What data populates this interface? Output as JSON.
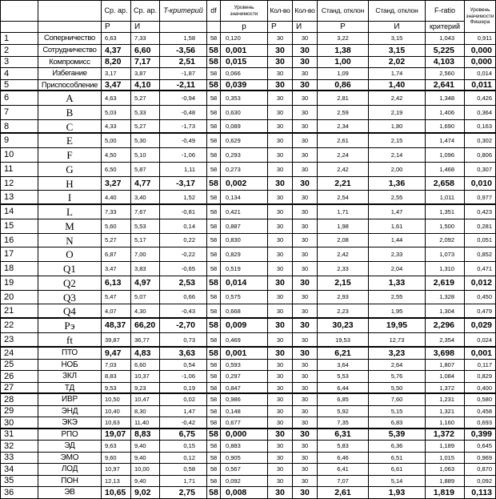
{
  "header": {
    "top": [
      "",
      "",
      "Ср. ар.",
      "Ср. ар.",
      "T-критерий",
      "df",
      "Уровень значимости",
      "Кол-во",
      "Кол-во",
      "Станд. отклон",
      "Станд. отклон",
      "F-ratio",
      "Уровень значимости Фишера"
    ],
    "sub": [
      "",
      "",
      "Р",
      "И",
      "",
      "",
      "р",
      "Р",
      "И",
      "Р",
      "И",
      "критерий"
    ]
  },
  "rows": [
    {
      "no": "1",
      "name": "Соперничество",
      "values": [
        "6,63",
        "7,33",
        "1,58",
        "58",
        "0,120",
        "30",
        "30",
        "3,22",
        "3,15",
        "1,043",
        "0,911"
      ],
      "bold": false
    },
    {
      "no": "2",
      "name": "Сотрудничество",
      "values": [
        "4,37",
        "6,60",
        "-3,56",
        "58",
        "0,001",
        "30",
        "30",
        "1,38",
        "3,15",
        "5,225",
        "0,000"
      ],
      "bold": true
    },
    {
      "no": "3",
      "name": "Компромисс",
      "values": [
        "8,20",
        "7,17",
        "2,51",
        "58",
        "0,015",
        "30",
        "30",
        "1,00",
        "2,02",
        "4,103",
        "0,000"
      ],
      "bold": true
    },
    {
      "no": "4",
      "name": "Избегание",
      "values": [
        "3,17",
        "3,87",
        "-1,87",
        "58",
        "0,066",
        "30",
        "30",
        "1,09",
        "1,74",
        "2,560",
        "0,014"
      ],
      "bold": false
    },
    {
      "no": "5",
      "name": "Приспособление",
      "values": [
        "3,47",
        "4,10",
        "-2,11",
        "58",
        "0,039",
        "30",
        "30",
        "0,86",
        "1,40",
        "2,641",
        "0,011"
      ],
      "bold": true
    },
    {
      "no": "6",
      "name": "A",
      "values": [
        "4,63",
        "5,27",
        "-0,94",
        "58",
        "0,353",
        "30",
        "30",
        "2,81",
        "2,42",
        "1,348",
        "0,426"
      ],
      "bold": false
    },
    {
      "no": "7",
      "name": "B",
      "values": [
        "5,03",
        "5,33",
        "-0,48",
        "58",
        "0,630",
        "30",
        "30",
        "2,59",
        "2,19",
        "1,406",
        "0,364"
      ],
      "bold": false
    },
    {
      "no": "8",
      "name": "C",
      "values": [
        "4,33",
        "5,27",
        "-1,73",
        "58",
        "0,089",
        "30",
        "30",
        "2,34",
        "1,80",
        "1,690",
        "0,163"
      ],
      "bold": false
    },
    {
      "no": "9",
      "name": "E",
      "values": [
        "5,00",
        "5,30",
        "-0,49",
        "58",
        "0,629",
        "30",
        "30",
        "2,61",
        "2,15",
        "1,474",
        "0,302"
      ],
      "bold": false
    },
    {
      "no": "10",
      "name": "F",
      "values": [
        "4,50",
        "5,10",
        "-1,06",
        "58",
        "0,293",
        "30",
        "30",
        "2,24",
        "2,14",
        "1,096",
        "0,806"
      ],
      "bold": false
    },
    {
      "no": "11",
      "name": "G",
      "values": [
        "6,50",
        "5,87",
        "1,11",
        "58",
        "0,273",
        "30",
        "30",
        "2,42",
        "2,00",
        "1,468",
        "0,307"
      ],
      "bold": false
    },
    {
      "no": "12",
      "name": "H",
      "values": [
        "3,27",
        "4,77",
        "-3,17",
        "58",
        "0,002",
        "30",
        "30",
        "2,21",
        "1,36",
        "2,658",
        "0,010"
      ],
      "bold": true
    },
    {
      "no": "13",
      "name": "I",
      "values": [
        "4,40",
        "3,40",
        "1,52",
        "58",
        "0,134",
        "30",
        "30",
        "2,54",
        "2,55",
        "1,011",
        "0,977"
      ],
      "bold": false
    },
    {
      "no": "14",
      "name": "L",
      "values": [
        "7,33",
        "7,67",
        "-0,81",
        "58",
        "0,421",
        "30",
        "30",
        "1,71",
        "1,47",
        "1,351",
        "0,423"
      ],
      "bold": false
    },
    {
      "no": "15",
      "name": "M",
      "values": [
        "5,60",
        "5,53",
        "0,14",
        "58",
        "0,887",
        "30",
        "30",
        "1,98",
        "1,61",
        "1,500",
        "0,281"
      ],
      "bold": false
    },
    {
      "no": "16",
      "name": "N",
      "values": [
        "5,27",
        "5,17",
        "0,22",
        "58",
        "0,830",
        "30",
        "30",
        "2,08",
        "1,44",
        "2,092",
        "0,051"
      ],
      "bold": false
    },
    {
      "no": "17",
      "name": "O",
      "values": [
        "6,87",
        "7,00",
        "-0,22",
        "58",
        "0,829",
        "30",
        "30",
        "2,42",
        "2,33",
        "1,073",
        "0,852"
      ],
      "bold": false
    },
    {
      "no": "18",
      "name": "Q1",
      "values": [
        "3,47",
        "3,83",
        "-0,65",
        "58",
        "0,519",
        "30",
        "30",
        "2,33",
        "2,04",
        "1,310",
        "0,471"
      ],
      "bold": false
    },
    {
      "no": "19",
      "name": "Q2",
      "values": [
        "6,13",
        "4,97",
        "2,53",
        "58",
        "0,014",
        "30",
        "30",
        "2,15",
        "1,33",
        "2,619",
        "0,012"
      ],
      "bold": true
    },
    {
      "no": "20",
      "name": "Q3",
      "values": [
        "5,47",
        "5,07",
        "0,66",
        "58",
        "0,575",
        "30",
        "30",
        "2,93",
        "2,55",
        "1,328",
        "0,450"
      ],
      "bold": false
    },
    {
      "no": "21",
      "name": "Q4",
      "values": [
        "4,07",
        "4,30",
        "-0,43",
        "58",
        "0,668",
        "30",
        "30",
        "2,23",
        "1,95",
        "1,304",
        "0,479"
      ],
      "bold": false
    },
    {
      "no": "22",
      "name": "Рэ",
      "values": [
        "48,37",
        "66,20",
        "-2,70",
        "58",
        "0,009",
        "30",
        "30",
        "30,23",
        "19,95",
        "2,296",
        "0,029"
      ],
      "bold": true
    },
    {
      "no": "23",
      "name": "ft",
      "values": [
        "39,87",
        "36,77",
        "0,73",
        "58",
        "0,469",
        "30",
        "30",
        "19,53",
        "12,73",
        "2,354",
        "0,024"
      ],
      "bold": false
    },
    {
      "no": "24",
      "name": "ПТО",
      "values": [
        "9,47",
        "4,83",
        "3,63",
        "58",
        "0,001",
        "30",
        "30",
        "6,21",
        "3,23",
        "3,698",
        "0,001"
      ],
      "bold": true
    },
    {
      "no": "25",
      "name": "НОБ",
      "values": [
        "7,03",
        "6,60",
        "0,54",
        "58",
        "0,593",
        "30",
        "30",
        "3,64",
        "2,64",
        "1,807",
        "0,117"
      ],
      "bold": false
    },
    {
      "no": "26",
      "name": "ЗКЛ",
      "values": [
        "8,83",
        "10,37",
        "-1,06",
        "58",
        "0,297",
        "30",
        "30",
        "5,53",
        "5,76",
        "1,084",
        "0,829"
      ],
      "bold": false
    },
    {
      "no": "27",
      "name": "ТД",
      "values": [
        "9,53",
        "9,23",
        "0,19",
        "58",
        "0,847",
        "30",
        "30",
        "6,44",
        "5,50",
        "1,372",
        "0,400"
      ],
      "bold": false
    },
    {
      "no": "28",
      "name": "ИВР",
      "values": [
        "10,50",
        "10,47",
        "0,02",
        "58",
        "0,986",
        "30",
        "30",
        "6,85",
        "7,60",
        "1,231",
        "0,580"
      ],
      "bold": false
    },
    {
      "no": "29",
      "name": "ЭНД",
      "values": [
        "10,40",
        "8,30",
        "1,47",
        "58",
        "0,148",
        "30",
        "30",
        "5,92",
        "5,15",
        "1,321",
        "0,458"
      ],
      "bold": false
    },
    {
      "no": "30",
      "name": "ЭКЭ",
      "values": [
        "10,63",
        "11,40",
        "-0,42",
        "58",
        "0,677",
        "30",
        "30",
        "7,35",
        "6,83",
        "1,160",
        "0,693"
      ],
      "bold": false
    },
    {
      "no": "31",
      "name": "РПО",
      "values": [
        "19,07",
        "8,83",
        "6,75",
        "58",
        "0,000",
        "30",
        "30",
        "6,31",
        "5,39",
        "1,372",
        "0,399"
      ],
      "bold": true
    },
    {
      "no": "32",
      "name": "ЭД",
      "values": [
        "9,63",
        "9,40",
        "0,15",
        "58",
        "0,883",
        "30",
        "30",
        "5,83",
        "6,36",
        "1,189",
        "0,645"
      ],
      "bold": false
    },
    {
      "no": "33",
      "name": "ЭМО",
      "values": [
        "9,60",
        "9,40",
        "0,12",
        "58",
        "0,905",
        "30",
        "30",
        "6,46",
        "6,51",
        "1,015",
        "0,969"
      ],
      "bold": false
    },
    {
      "no": "34",
      "name": "ЛОД",
      "values": [
        "10,97",
        "10,00",
        "0,58",
        "58",
        "0,567",
        "30",
        "30",
        "6,41",
        "6,61",
        "1,063",
        "0,870"
      ],
      "bold": false
    },
    {
      "no": "35",
      "name": "ПОН",
      "values": [
        "12,13",
        "9,40",
        "1,71",
        "58",
        "0,092",
        "30",
        "30",
        "7,07",
        "5,14",
        "1,889",
        "0,092"
      ],
      "bold": false
    },
    {
      "no": "36",
      "name": "ЭВ",
      "values": [
        "10,65",
        "9,02",
        "2,75",
        "58",
        "0,008",
        "30",
        "30",
        "2,61",
        "1,93",
        "1,819",
        "0,113"
      ],
      "bold": true
    }
  ]
}
